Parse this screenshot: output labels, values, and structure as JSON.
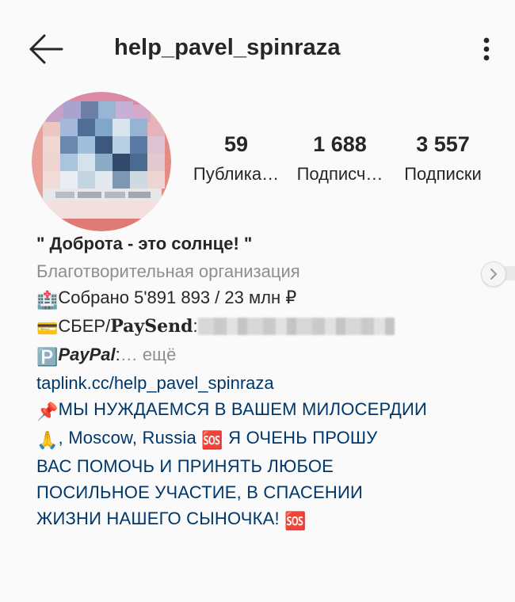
{
  "header": {
    "username": "help_pavel_spinraza",
    "back_icon": "back-arrow-icon",
    "more_icon": "more-vertical-icon"
  },
  "stats": {
    "posts": {
      "count": "59",
      "label": "Публика…"
    },
    "followers": {
      "count": "1 688",
      "label": "Подписч…"
    },
    "following": {
      "count": "3 557",
      "label": "Подписки"
    }
  },
  "bio": {
    "title": "\" Доброта - это солнце! \"",
    "category": "Благотворительная организация",
    "collected_icon": "🏥",
    "collected": "Собрано 5'891 893 / 23 млн ₽",
    "card_icon": "💳",
    "sber_prefix": "СБЕР/",
    "paysend": "PaySend",
    "paysend_colon": ":",
    "paypal_icon": "🅿️",
    "paypal": "PayPal",
    "paypal_colon": ":",
    "more": "… ещё",
    "link": "taplink.cc/help_pavel_spinraza",
    "pin_icon": "📌",
    "line1": "МЫ НУЖДАЕМСЯ В ВАШЕМ МИЛОСЕРДИИ",
    "pray_icon": "🙏",
    "line2_a": ", Moscow, Russia ",
    "sos_icon": "🆘",
    "line2_b": " Я ОЧЕНЬ ПРОШУ",
    "line3": "ВАС ПОМОЧЬ И ПРИНЯТЬ ЛЮБОЕ",
    "line4": "ПОСИЛЬНОЕ УЧАСТИЕ, В СПАСЕНИИ",
    "line5": "ЖИЗНИ НАШЕГО СЫНОЧКА! ",
    "sos_icon_end": "🆘"
  },
  "colors": {
    "link_blue": "#00376b",
    "secondary_gray": "#8e8e8e",
    "text_dark": "#262626",
    "background": "#fafafa"
  },
  "carousel": {
    "arrow_icon": "chevron-right-icon"
  }
}
